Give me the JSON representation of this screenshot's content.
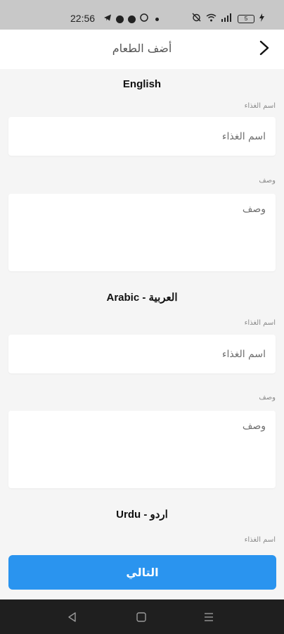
{
  "status_bar": {
    "time": "22:56",
    "battery": "5",
    "left_icons": [
      "telegram-icon",
      "messenger-icon",
      "messenger-icon",
      "whatsapp-icon",
      "dot-icon"
    ],
    "right_icons": [
      "alarm-off-icon",
      "wifi-icon",
      "signal-icon",
      "battery-icon",
      "charging-icon"
    ]
  },
  "header": {
    "title": "أضف الطعام",
    "back_icon": "chevron-right-icon"
  },
  "sections": [
    {
      "title": "English",
      "name_label": "اسم الغذاء",
      "name_placeholder": "اسم الغذاء",
      "desc_label": "وصف",
      "desc_placeholder": "وصف"
    },
    {
      "title": "Arabic - العربية",
      "name_label": "اسم الغذاء",
      "name_placeholder": "اسم الغذاء",
      "desc_label": "وصف",
      "desc_placeholder": "وصف"
    },
    {
      "title": "Urdu - اردو",
      "name_label": "اسم الغذاء"
    }
  ],
  "next_button": {
    "label": "التالي",
    "color": "#2a94ef"
  },
  "nav_bar": {
    "icons": [
      "back-triangle-icon",
      "home-square-icon",
      "menu-lines-icon"
    ]
  }
}
